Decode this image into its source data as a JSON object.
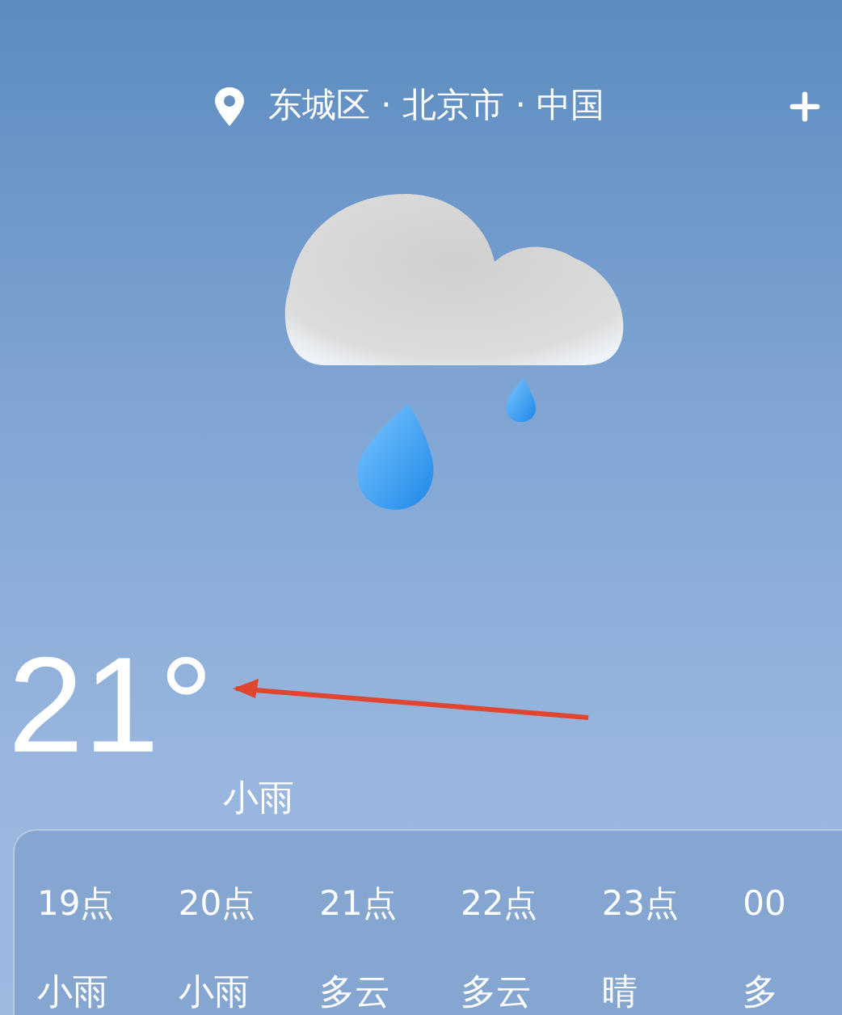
{
  "location": "东城区 · 北京市 · 中国",
  "current": {
    "temperature": "21°",
    "condition": "小雨"
  },
  "hourly": [
    {
      "hour": "19点",
      "condition": "小雨"
    },
    {
      "hour": "20点",
      "condition": "小雨"
    },
    {
      "hour": "21点",
      "condition": "多云"
    },
    {
      "hour": "22点",
      "condition": "多云"
    },
    {
      "hour": "23点",
      "condition": "晴"
    },
    {
      "hour": "00",
      "condition": "多"
    }
  ]
}
